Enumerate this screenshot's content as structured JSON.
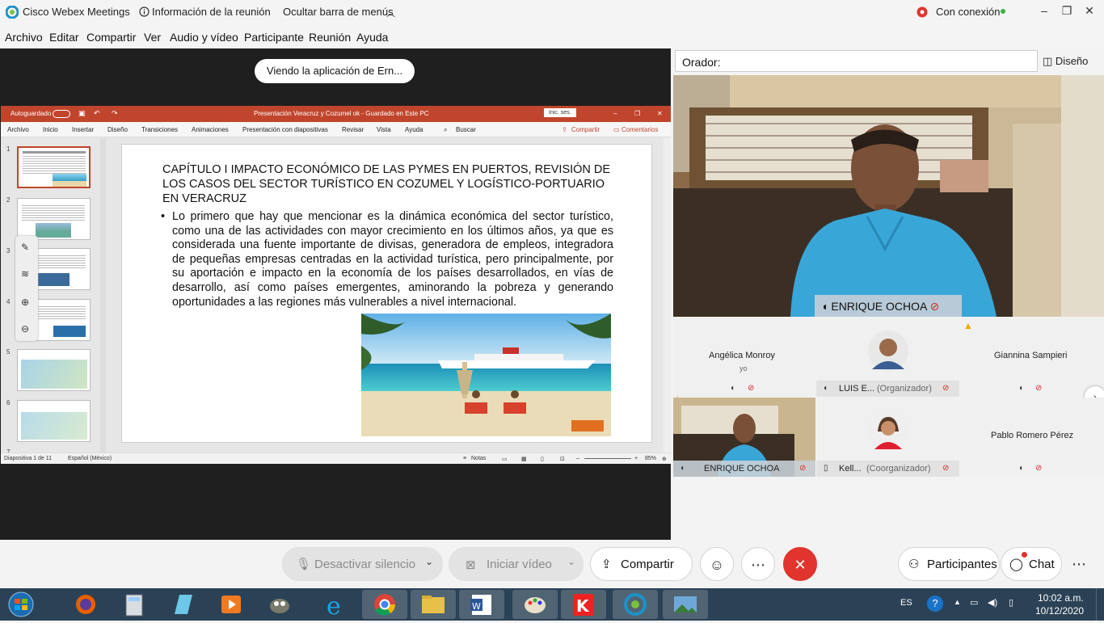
{
  "titlebar": {
    "app_name": "Cisco Webex Meetings",
    "meeting_info": "Información de la reunión",
    "hide_menu": "Ocultar barra de menús",
    "status": "Con conexión"
  },
  "menu": [
    "Archivo",
    "Editar",
    "Compartir",
    "Ver",
    "Audio y vídeo",
    "Participante",
    "Reunión",
    "Ayuda"
  ],
  "share": {
    "viewing_label": "Viendo la aplicación de Ern..."
  },
  "ppt": {
    "autosave": "Autoguardado",
    "doc_title": "Presentación Veracruz y Cozumel ok  -  Guardado en Este PC",
    "signin": "Inic. ses.",
    "tabs": [
      "Archivo",
      "Inicio",
      "Insertar",
      "Diseño",
      "Transiciones",
      "Animaciones",
      "Presentación con diapositivas",
      "Revisar",
      "Vista",
      "Ayuda"
    ],
    "search": "Buscar",
    "share": "Compartir",
    "comments": "Comentarios",
    "thumb_numbers": [
      "1",
      "2",
      "3",
      "4",
      "5",
      "6",
      "7"
    ],
    "slide_title": "CAPÍTULO I IMPACTO ECONÓMICO DE LAS PYMES EN PUERTOS, REVISIÓN DE LOS CASOS DEL SECTOR TURÍSTICO EN COZUMEL Y LOGÍSTICO-PORTUARIO EN VERACRUZ",
    "bullet": "•",
    "slide_body": "Lo primero que hay que mencionar es la dinámica económica del sector turístico, como una de las actividades con mayor crecimiento en los últimos años, ya que es considerada una fuente importante de divisas, generadora de empleos, integradora de pequeñas empresas centradas en la actividad turística, pero principalmente, por su aportación e impacto en la economía de los países desarrollados, en vías de desarrollo, así como países emergentes, aminorando la pobreza y generando oportunidades a las regiones más vulnerables a nivel internacional.",
    "status_slide": "Diapositiva 1 de 11",
    "status_lang": "Español (México)",
    "status_notes": "Notas",
    "zoom": "85%"
  },
  "right": {
    "orador_label": "Orador:",
    "design_label": "Diseño",
    "main_name": "ENRIQUE OCHOA",
    "participants": [
      {
        "name": "Angélica Monroy",
        "sub": "yo"
      },
      {
        "name": "LUIS E...",
        "role": "(Organizador)"
      },
      {
        "name": "Giannina Sampieri"
      },
      {
        "name": "ENRIQUE OCHOA"
      },
      {
        "name": "Kell...",
        "role": "(Coorganizador)"
      },
      {
        "name": "Pablo Romero Pérez"
      }
    ]
  },
  "controls": {
    "mute": "Desactivar silencio",
    "video": "Iniciar vídeo",
    "share": "Compartir",
    "participants": "Participantes",
    "chat": "Chat"
  },
  "taskbar": {
    "lang": "ES",
    "time": "10:02 a.m.",
    "date": "10/12/2020"
  },
  "colors": {
    "ppt_accent": "#c0452c",
    "end_call": "#e0342c",
    "taskbar": "#2b4256",
    "status_dot": "#3cb043"
  }
}
